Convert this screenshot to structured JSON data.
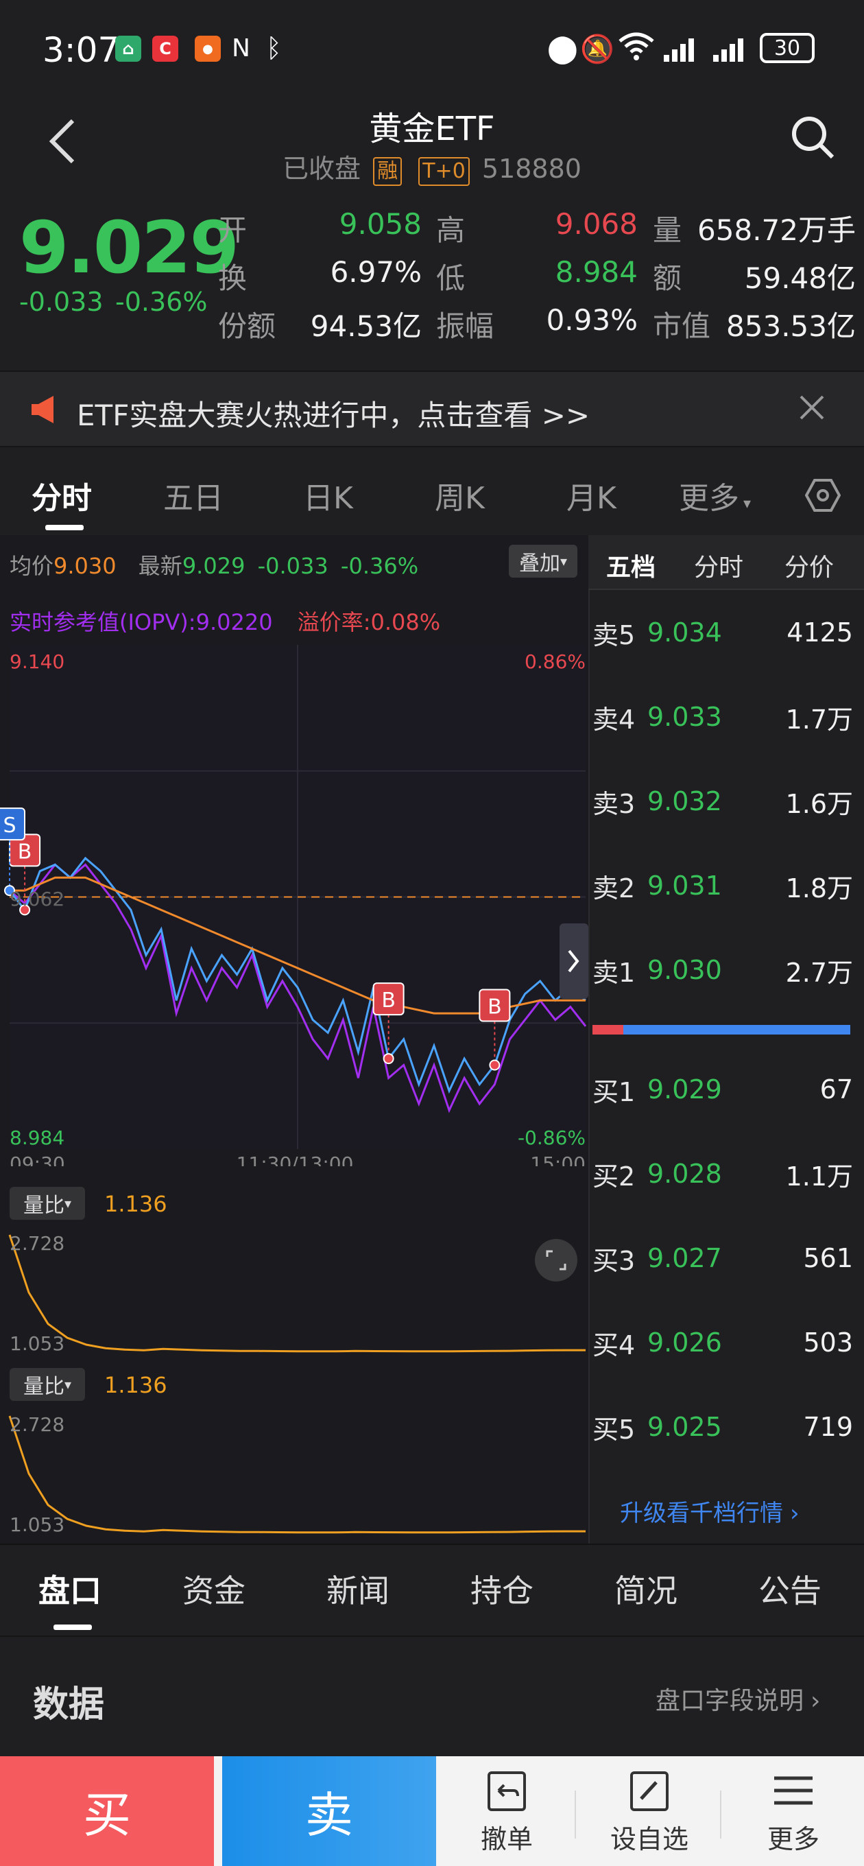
{
  "status": {
    "time": "3:07",
    "battery": "30"
  },
  "nav": {
    "title": "黄金ETF",
    "state": "已收盘",
    "tag_margin": "融",
    "tag_t0": "T+0",
    "code": "518880"
  },
  "quote": {
    "price": "9.029",
    "change": "-0.033",
    "change_pct": "-0.36%",
    "fields": [
      {
        "label": "开",
        "value": "9.058"
      },
      {
        "label": "高",
        "value": "9.068"
      },
      {
        "label": "量",
        "value": "658.72万手"
      },
      {
        "label": "换",
        "value": "6.97%"
      },
      {
        "label": "低",
        "value": "8.984"
      },
      {
        "label": "额",
        "value": "59.48亿"
      },
      {
        "label": "份额",
        "value": "94.53亿"
      },
      {
        "label": "振幅",
        "value": "0.93%"
      },
      {
        "label": "市值",
        "value": "853.53亿"
      }
    ]
  },
  "banner": {
    "text": "ETF实盘大赛火热进行中，点击查看 >>"
  },
  "chart_tabs": [
    "分时",
    "五日",
    "日K",
    "周K",
    "月K",
    "更多"
  ],
  "chart_legend": {
    "avg_label": "均价",
    "avg_value": "9.030",
    "latest_label": "最新",
    "latest_value": "9.029",
    "latest_change": "-0.033",
    "latest_pct": "-0.36%",
    "overlay_button": "叠加",
    "iopv_label": "实时参考值(IOPV):",
    "iopv_value": "9.0220",
    "premium_label": "溢价率:",
    "premium_value": "0.08%"
  },
  "chart_data": {
    "type": "line",
    "title": "",
    "ylim": [
      8.984,
      9.14
    ],
    "y_top_label": "9.140",
    "y_bottom_label": "8.984",
    "y_mid_label": "9.062",
    "pct_top_label": "0.86%",
    "pct_bottom_label": "-0.86%",
    "x_labels": [
      "09:30",
      "11:30/13:00",
      "15:00"
    ],
    "series": [
      {
        "name": "最新",
        "color": "#4aa3ff",
        "values": [
          9.064,
          9.058,
          9.07,
          9.072,
          9.068,
          9.074,
          9.07,
          9.064,
          9.058,
          9.044,
          9.052,
          9.03,
          9.046,
          9.036,
          9.044,
          9.038,
          9.046,
          9.03,
          9.04,
          9.034,
          9.024,
          9.02,
          9.03,
          9.014,
          9.034,
          9.012,
          9.018,
          9.004,
          9.016,
          9.002,
          9.012,
          9.004,
          9.01,
          9.024,
          9.032,
          9.036,
          9.03,
          9.034,
          9.03
        ]
      },
      {
        "name": "均价",
        "color": "#f08a2c",
        "values": [
          9.064,
          9.064,
          9.066,
          9.068,
          9.068,
          9.068,
          9.066,
          9.064,
          9.062,
          9.06,
          9.058,
          9.056,
          9.054,
          9.052,
          9.05,
          9.048,
          9.046,
          9.044,
          9.042,
          9.04,
          9.038,
          9.036,
          9.034,
          9.032,
          9.03,
          9.029,
          9.028,
          9.027,
          9.026,
          9.026,
          9.026,
          9.026,
          9.027,
          9.028,
          9.029,
          9.03,
          9.03,
          9.03,
          9.03
        ]
      },
      {
        "name": "实时参考值(IOPV)",
        "color": "#a22ef0",
        "values": [
          9.064,
          9.06,
          9.066,
          9.072,
          9.068,
          9.072,
          9.066,
          9.06,
          9.052,
          9.04,
          9.05,
          9.026,
          9.04,
          9.03,
          9.04,
          9.034,
          9.044,
          9.028,
          9.036,
          9.028,
          9.018,
          9.012,
          9.024,
          9.006,
          9.028,
          9.006,
          9.01,
          8.998,
          9.01,
          8.996,
          9.006,
          8.998,
          9.004,
          9.018,
          9.024,
          9.03,
          9.024,
          9.028,
          9.022
        ]
      }
    ],
    "markers": [
      {
        "label": "B",
        "index": 1,
        "value": 9.058
      },
      {
        "label": "S",
        "index": 0,
        "value": 9.064
      },
      {
        "label": "B",
        "index": 25,
        "value": 9.012
      },
      {
        "label": "B",
        "index": 32,
        "value": 9.01
      }
    ]
  },
  "volume_ratio": {
    "label": "量比",
    "value": "1.136",
    "top": "2.728",
    "bottom": "1.053",
    "values": [
      2.728,
      1.9,
      1.45,
      1.25,
      1.15,
      1.1,
      1.08,
      1.07,
      1.09,
      1.08,
      1.07,
      1.065,
      1.06,
      1.06,
      1.058,
      1.056,
      1.055,
      1.055,
      1.06,
      1.058,
      1.057,
      1.056,
      1.055,
      1.056,
      1.058,
      1.06,
      1.062,
      1.066,
      1.07,
      1.072,
      1.072
    ]
  },
  "depth": {
    "tabs": [
      "五档",
      "分时",
      "分价"
    ],
    "asks": [
      {
        "label": "卖5",
        "price": "9.034",
        "vol": "4125"
      },
      {
        "label": "卖4",
        "price": "9.033",
        "vol": "1.7万"
      },
      {
        "label": "卖3",
        "price": "9.032",
        "vol": "1.6万"
      },
      {
        "label": "卖2",
        "price": "9.031",
        "vol": "1.8万"
      },
      {
        "label": "卖1",
        "price": "9.030",
        "vol": "2.7万"
      }
    ],
    "bids": [
      {
        "label": "买1",
        "price": "9.029",
        "vol": "67"
      },
      {
        "label": "买2",
        "price": "9.028",
        "vol": "1.1万"
      },
      {
        "label": "买3",
        "price": "9.027",
        "vol": "561"
      },
      {
        "label": "买4",
        "price": "9.026",
        "vol": "503"
      },
      {
        "label": "买5",
        "price": "9.025",
        "vol": "719"
      }
    ],
    "ratio_sell_share": 0.12,
    "upgrade_link": "升级看千档行情"
  },
  "bottom_tabs": [
    "盘口",
    "资金",
    "新闻",
    "持仓",
    "简况",
    "公告"
  ],
  "data_section": {
    "title": "数据",
    "link": "盘口字段说明"
  },
  "actions": {
    "buy": "买",
    "sell": "卖",
    "cancel": "撤单",
    "watchlist": "设自选",
    "more": "更多"
  },
  "colors": {
    "up": "#e8484f",
    "down": "#39c25a",
    "accent_orange": "#f08a2c",
    "price_line": "#4aa3ff",
    "iopv_line": "#a22ef0"
  }
}
